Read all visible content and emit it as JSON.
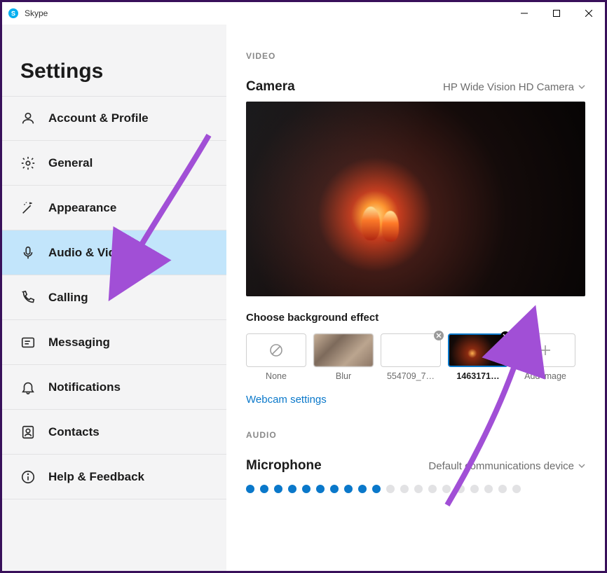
{
  "titlebar": {
    "app_name": "Skype"
  },
  "sidebar": {
    "title": "Settings",
    "items": [
      {
        "label": "Account & Profile",
        "icon": "profile-icon"
      },
      {
        "label": "General",
        "icon": "gear-icon"
      },
      {
        "label": "Appearance",
        "icon": "wand-icon"
      },
      {
        "label": "Audio & Video",
        "icon": "microphone-icon",
        "active": true
      },
      {
        "label": "Calling",
        "icon": "phone-icon"
      },
      {
        "label": "Messaging",
        "icon": "message-icon"
      },
      {
        "label": "Notifications",
        "icon": "bell-icon"
      },
      {
        "label": "Contacts",
        "icon": "contacts-icon"
      },
      {
        "label": "Help & Feedback",
        "icon": "info-icon"
      }
    ]
  },
  "main": {
    "video": {
      "section": "VIDEO",
      "camera_label": "Camera",
      "camera_selected": "HP Wide Vision HD Camera",
      "background_effect_label": "Choose background effect",
      "effects": [
        {
          "label": "None",
          "kind": "none"
        },
        {
          "label": "Blur",
          "kind": "blur"
        },
        {
          "label": "554709_7…",
          "kind": "image",
          "removable": true
        },
        {
          "label": "1463171…",
          "kind": "image-dark",
          "selected": true,
          "removable": true
        },
        {
          "label": "Add image",
          "kind": "add"
        }
      ],
      "webcam_settings_link": "Webcam settings"
    },
    "audio": {
      "section": "AUDIO",
      "microphone_label": "Microphone",
      "microphone_selected": "Default communications device",
      "level_dots_active": 10,
      "level_dots_total": 20
    }
  }
}
